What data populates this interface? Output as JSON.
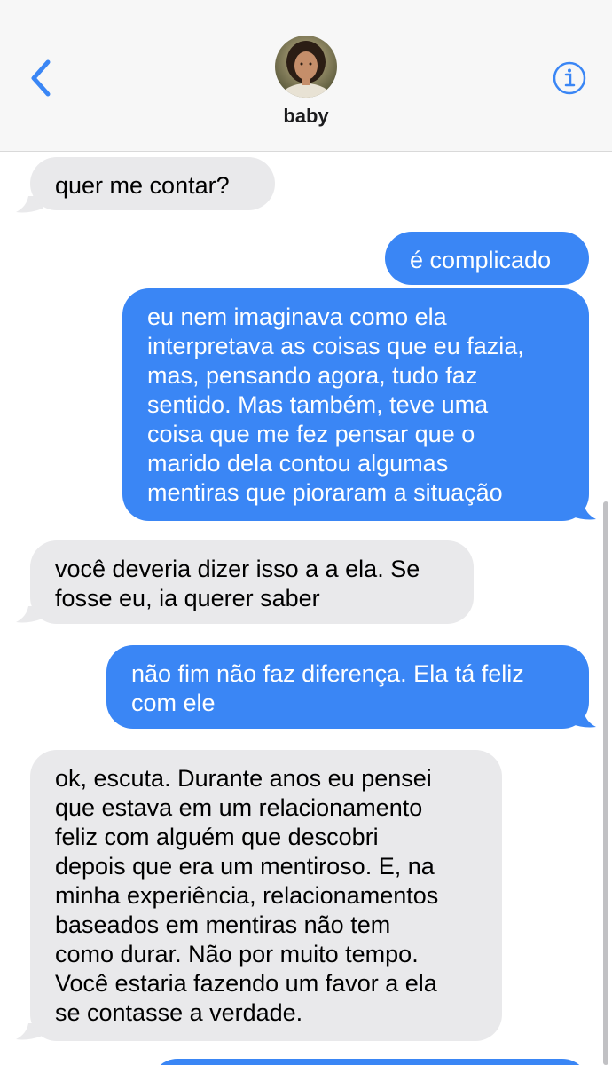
{
  "contact": {
    "name": "baby"
  },
  "colors": {
    "accent": "#3a86f5",
    "incoming_bubble": "#e9e9eb",
    "header_bg": "#f7f7f7"
  },
  "icons": {
    "back": "chevron-left-icon",
    "info": "info-circle-icon"
  },
  "messages": [
    {
      "direction": "in",
      "text": "quer me contar?"
    },
    {
      "direction": "out",
      "text": "é complicado"
    },
    {
      "direction": "out",
      "text": "eu nem imaginava como ela\ninterpretava as coisas que eu fazia,\nmas, pensando agora, tudo faz\nsentido. Mas também, teve uma\ncoisa que me fez pensar que o\nmarido dela contou algumas\nmentiras que pioraram a situação"
    },
    {
      "direction": "in",
      "text": "você deveria dizer isso a a ela. Se\nfosse eu, ia querer saber"
    },
    {
      "direction": "out",
      "text": "não fim não faz diferença. Ela tá feliz\ncom ele"
    },
    {
      "direction": "in",
      "text": "ok, escuta. Durante anos eu pensei\nque estava em um relacionamento\nfeliz com alguém que descobri\ndepois que era um mentiroso. E, na\nminha experiência, relacionamentos\nbaseados em mentiras não tem\ncomo durar. Não por muito tempo.\nVocê estaria fazendo um favor a ela\nse contasse a verdade."
    },
    {
      "direction": "out",
      "text": ""
    }
  ]
}
